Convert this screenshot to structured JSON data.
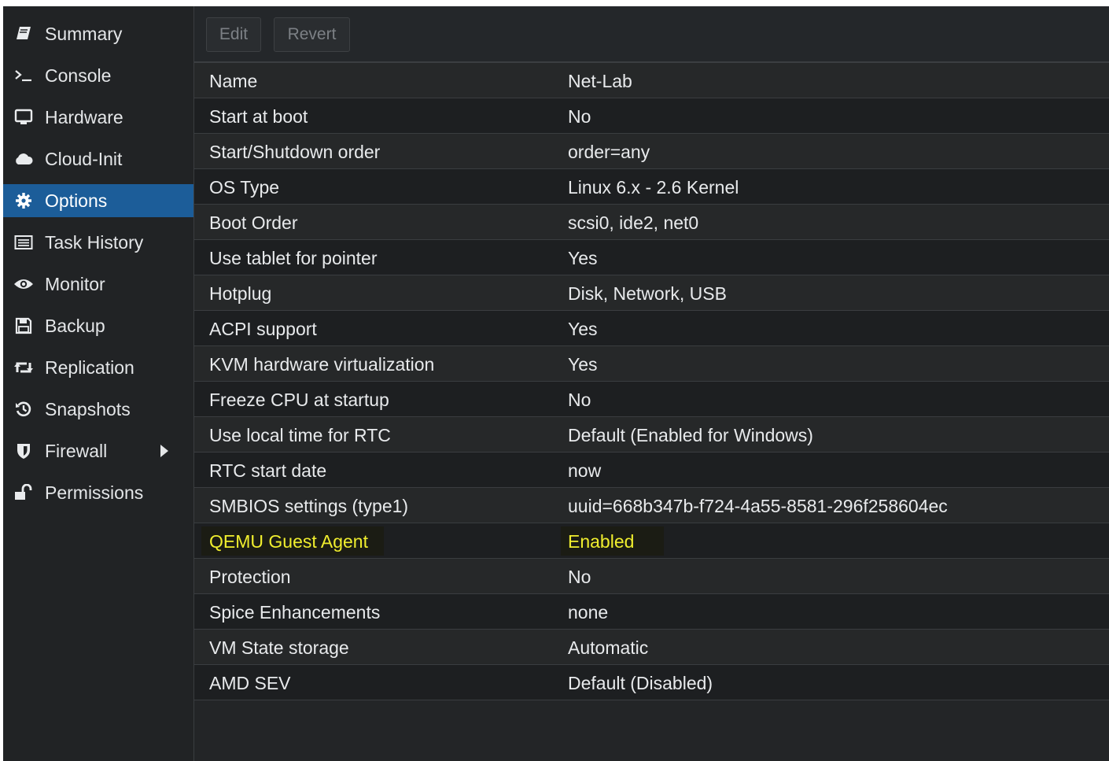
{
  "sidebar": {
    "items": [
      {
        "label": "Summary",
        "icon": "book-icon"
      },
      {
        "label": "Console",
        "icon": "terminal-icon"
      },
      {
        "label": "Hardware",
        "icon": "monitor-icon"
      },
      {
        "label": "Cloud-Init",
        "icon": "cloud-icon"
      },
      {
        "label": "Options",
        "icon": "gear-icon",
        "active": true
      },
      {
        "label": "Task History",
        "icon": "list-icon"
      },
      {
        "label": "Monitor",
        "icon": "eye-icon"
      },
      {
        "label": "Backup",
        "icon": "floppy-disk-icon"
      },
      {
        "label": "Replication",
        "icon": "retweet-icon"
      },
      {
        "label": "Snapshots",
        "icon": "history-icon"
      },
      {
        "label": "Firewall",
        "icon": "shield-icon"
      },
      {
        "label": "Permissions",
        "icon": "unlock-icon"
      }
    ]
  },
  "toolbar": {
    "edit_label": "Edit",
    "revert_label": "Revert"
  },
  "options": [
    {
      "key": "Name",
      "value": "Net-Lab"
    },
    {
      "key": "Start at boot",
      "value": "No"
    },
    {
      "key": "Start/Shutdown order",
      "value": "order=any"
    },
    {
      "key": "OS Type",
      "value": "Linux 6.x - 2.6 Kernel"
    },
    {
      "key": "Boot Order",
      "value": "scsi0, ide2, net0"
    },
    {
      "key": "Use tablet for pointer",
      "value": "Yes"
    },
    {
      "key": "Hotplug",
      "value": "Disk, Network, USB"
    },
    {
      "key": "ACPI support",
      "value": "Yes"
    },
    {
      "key": "KVM hardware virtualization",
      "value": "Yes"
    },
    {
      "key": "Freeze CPU at startup",
      "value": "No"
    },
    {
      "key": "Use local time for RTC",
      "value": "Default (Enabled for Windows)"
    },
    {
      "key": "RTC start date",
      "value": "now"
    },
    {
      "key": "SMBIOS settings (type1)",
      "value": "uuid=668b347b-f724-4a55-8581-296f258604ec"
    },
    {
      "key": "QEMU Guest Agent",
      "value": "Enabled",
      "highlighted": true
    },
    {
      "key": "Protection",
      "value": "No"
    },
    {
      "key": "Spice Enhancements",
      "value": "none"
    },
    {
      "key": "VM State storage",
      "value": "Automatic"
    },
    {
      "key": "AMD SEV",
      "value": "Default (Disabled)"
    }
  ],
  "colors": {
    "active_nav": "#1c5d99",
    "highlight_text": "#f0ee2e"
  }
}
